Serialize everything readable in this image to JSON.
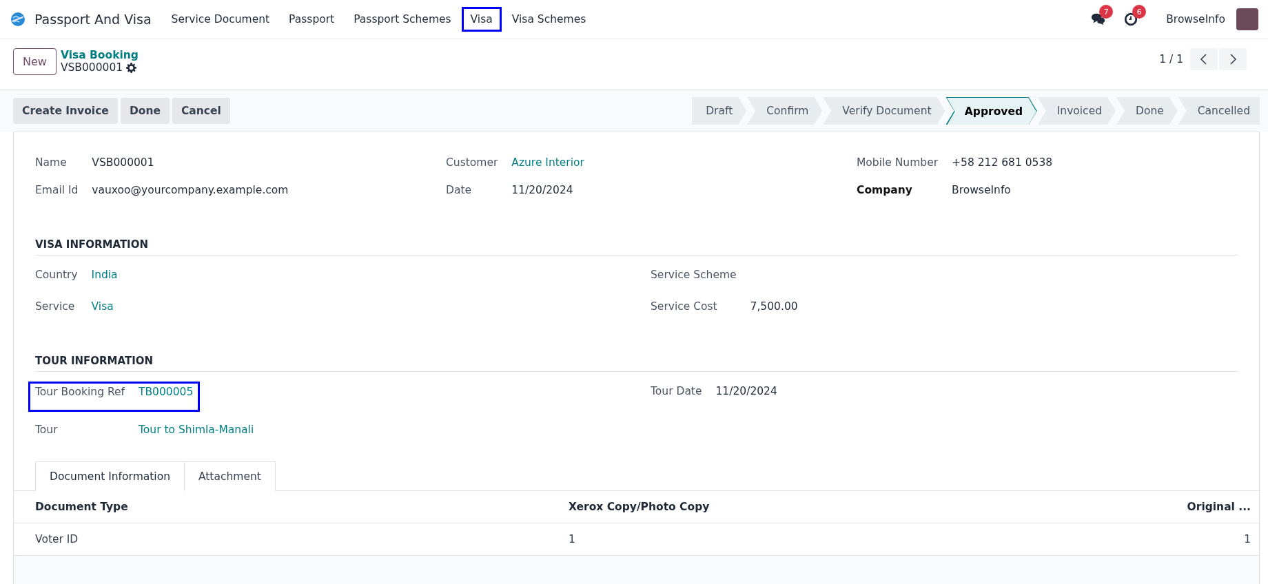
{
  "app": {
    "name": "Passport And Visa"
  },
  "menu": [
    {
      "label": "Service Document",
      "highlighted": false
    },
    {
      "label": "Passport",
      "highlighted": false
    },
    {
      "label": "Passport Schemes",
      "highlighted": false
    },
    {
      "label": "Visa",
      "highlighted": true
    },
    {
      "label": "Visa Schemes",
      "highlighted": false
    }
  ],
  "systray": {
    "messages_count": "7",
    "activities_count": "6",
    "company": "BrowseInfo"
  },
  "control_panel": {
    "new_button": "New",
    "breadcrumb": "Visa Booking",
    "record": "VSB000001",
    "pager": "1 / 1"
  },
  "actions": [
    "Create Invoice",
    "Done",
    "Cancel"
  ],
  "stages": [
    {
      "label": "Draft",
      "selected": false
    },
    {
      "label": "Confirm",
      "selected": false
    },
    {
      "label": "Verify Document",
      "selected": false
    },
    {
      "label": "Approved",
      "selected": true
    },
    {
      "label": "Invoiced",
      "selected": false
    },
    {
      "label": "Done",
      "selected": false
    },
    {
      "label": "Cancelled",
      "selected": false
    }
  ],
  "header_columns": [
    [
      {
        "label": "Name",
        "value": "VSB000001",
        "kind": "text",
        "emphasized": false,
        "highlighted": false
      },
      {
        "label": "Email Id",
        "value": "vauxoo@yourcompany.example.com",
        "kind": "text",
        "emphasized": false,
        "highlighted": false
      }
    ],
    [
      {
        "label": "Customer",
        "value": "Azure Interior",
        "kind": "link",
        "emphasized": false,
        "highlighted": false
      },
      {
        "label": "Date",
        "value": "11/20/2024",
        "kind": "text",
        "emphasized": false,
        "highlighted": false
      }
    ],
    [
      {
        "label": "Mobile Number",
        "value": "+58 212 681 0538",
        "kind": "text",
        "emphasized": false,
        "highlighted": false
      },
      {
        "label": "Company",
        "value": "BrowseInfo",
        "kind": "text",
        "emphasized": true,
        "highlighted": false
      }
    ]
  ],
  "sections": [
    {
      "title": "VISA INFORMATION",
      "columns": [
        [
          {
            "label": "Country",
            "value": "India",
            "kind": "link",
            "emphasized": false,
            "highlighted": false
          },
          {
            "label": "Service",
            "value": "Visa",
            "kind": "link",
            "emphasized": false,
            "highlighted": false
          }
        ],
        [
          {
            "label": "Service Scheme",
            "emphasized": false,
            "highlighted": false
          },
          {
            "label": "Service Cost",
            "value": "7,500.00",
            "kind": "text",
            "emphasized": false,
            "highlighted": false
          }
        ]
      ]
    },
    {
      "title": "TOUR INFORMATION",
      "columns": [
        [
          {
            "label": "Tour Booking Ref",
            "value": "TB000005",
            "kind": "link",
            "emphasized": false,
            "highlighted": true
          },
          {
            "label": "Tour",
            "value": "Tour to Shimla-Manali",
            "kind": "link",
            "emphasized": false,
            "highlighted": false
          }
        ],
        [
          {
            "label": "Tour Date",
            "value": "11/20/2024",
            "kind": "text",
            "emphasized": false,
            "highlighted": false
          }
        ]
      ]
    }
  ],
  "tabs": [
    {
      "label": "Document Information",
      "selected": true
    },
    {
      "label": "Attachment",
      "selected": false
    }
  ],
  "table": {
    "columns": [
      "Document Type",
      "Xerox Copy/Photo Copy",
      "Original ..."
    ],
    "rows": [
      [
        "Voter ID",
        "1",
        "1"
      ]
    ]
  }
}
